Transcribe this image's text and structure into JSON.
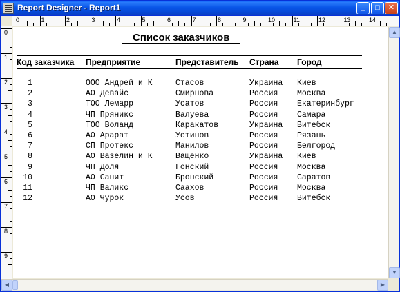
{
  "window": {
    "title": "Report Designer - Report1",
    "buttons": {
      "minimize": "_",
      "maximize": "□",
      "close": "✕"
    }
  },
  "ruler": {
    "horizontal": [
      "0",
      "1",
      "2",
      "3",
      "4",
      "5",
      "6",
      "7",
      "8",
      "9",
      "10",
      "11",
      "12",
      "13",
      "14"
    ],
    "vertical": [
      "0",
      "1",
      "2",
      "3",
      "4",
      "5",
      "6",
      "7",
      "8",
      "9"
    ]
  },
  "report": {
    "title": "Список заказчиков",
    "columns": {
      "code": "Код заказчика",
      "enterprise": "Предприятие",
      "representative": "Представитель",
      "country": "Страна",
      "city": "Город"
    },
    "rows": [
      {
        "code": "1",
        "enterprise": "ООО Андрей и К",
        "representative": "Стасов",
        "country": "Украина",
        "city": "Киев"
      },
      {
        "code": "2",
        "enterprise": "АО Девайс",
        "representative": "Смирнова",
        "country": "Россия",
        "city": "Москва"
      },
      {
        "code": "3",
        "enterprise": "ТОО Лемарр",
        "representative": "Усатов",
        "country": "Россия",
        "city": "Екатеринбург"
      },
      {
        "code": "4",
        "enterprise": "ЧП Пряникс",
        "representative": "Валуева",
        "country": "Россия",
        "city": "Самара"
      },
      {
        "code": "5",
        "enterprise": "ТОО Воланд",
        "representative": "Каракатов",
        "country": "Украина",
        "city": "Витебск"
      },
      {
        "code": "6",
        "enterprise": "АО Арарат",
        "representative": "Устинов",
        "country": "Россия",
        "city": "Рязань"
      },
      {
        "code": "7",
        "enterprise": "СП Протекс",
        "representative": "Манилов",
        "country": "Россия",
        "city": "Белгород"
      },
      {
        "code": "8",
        "enterprise": "АО Вазелин и К",
        "representative": "Ващенко",
        "country": "Украина",
        "city": "Киев"
      },
      {
        "code": "9",
        "enterprise": "ЧП Доля",
        "representative": "Гонский",
        "country": "Россия",
        "city": "Москва"
      },
      {
        "code": "10",
        "enterprise": "АО Санит",
        "representative": "Бронский",
        "country": "Россия",
        "city": "Саратов"
      },
      {
        "code": "11",
        "enterprise": "ЧП Валикс",
        "representative": "Саахов",
        "country": "Россия",
        "city": "Москва"
      },
      {
        "code": "12",
        "enterprise": "АО Чурок",
        "representative": "Усов",
        "country": "Россия",
        "city": "Витебск"
      }
    ]
  },
  "scrollbars": {
    "up": "▲",
    "down": "▼",
    "left": "◀",
    "right": "▶"
  },
  "colors": {
    "titlebar": "#0a56e8",
    "page": "#ffffff",
    "chrome": "#ece9d8"
  }
}
